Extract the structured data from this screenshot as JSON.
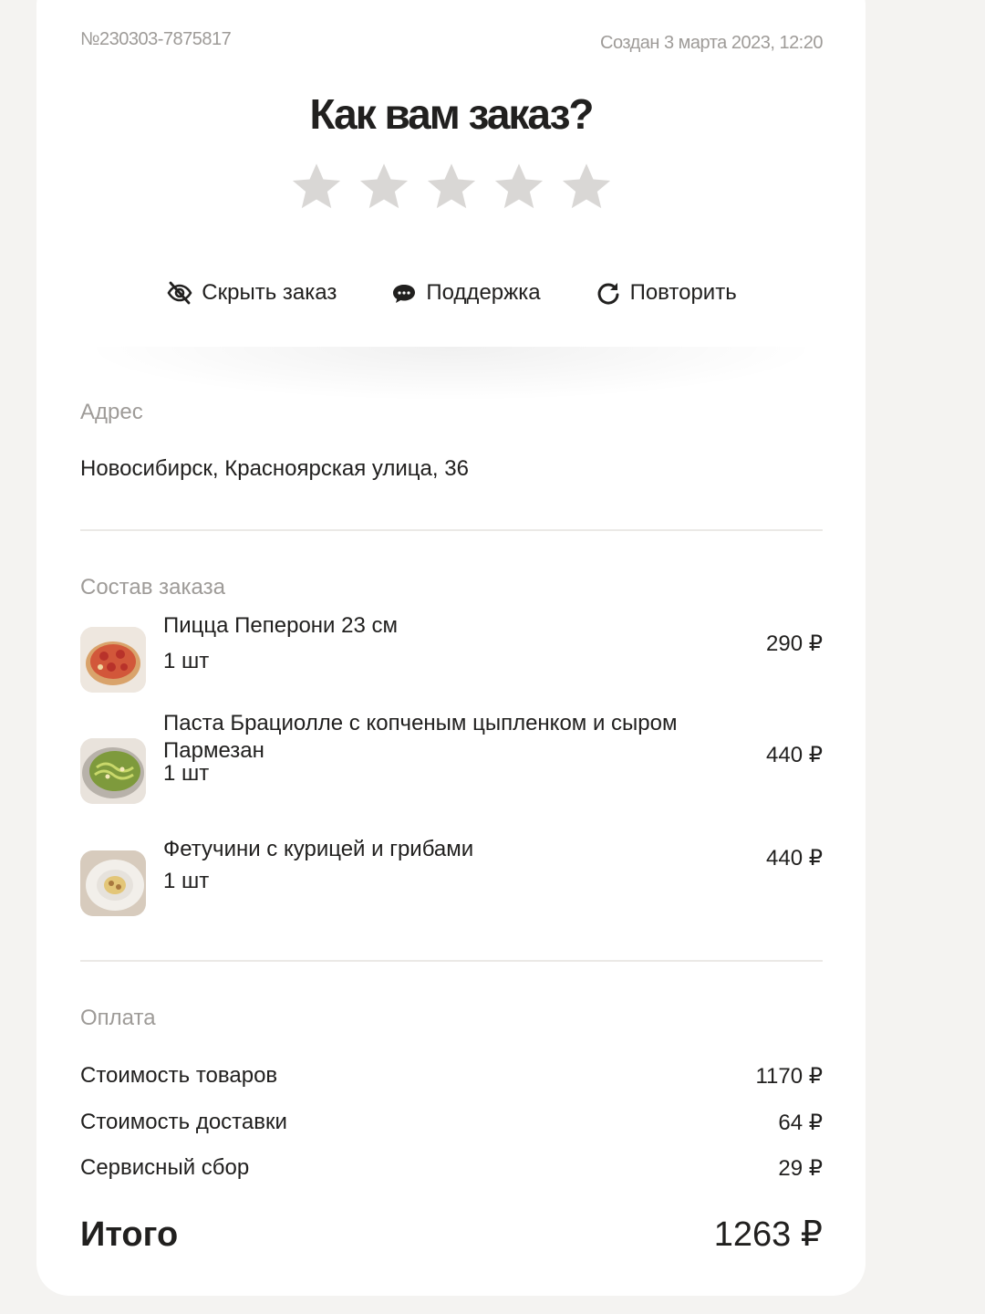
{
  "order": {
    "number": "№230303-7875817",
    "created": "Создан 3 марта 2023, 12:20",
    "title": "Как вам заказ?"
  },
  "rating": {
    "max_stars": 5,
    "selected": 0,
    "star_color": "#d9d7d5"
  },
  "actions": [
    {
      "label": "Скрыть заказ",
      "icon": "eye-off-icon"
    },
    {
      "label": "Поддержка",
      "icon": "chat-bubble-icon"
    },
    {
      "label": "Повторить",
      "icon": "refresh-icon"
    }
  ],
  "address": {
    "label": "Адрес",
    "value": "Новосибирск, Красноярская улица, 36"
  },
  "composition": {
    "label": "Состав заказа",
    "items": [
      {
        "name": "Пицца Пеперони 23 см",
        "qty": "1 шт",
        "price": "290 ₽",
        "image": "pizza-image"
      },
      {
        "name": "Паста Брациолле с копченым цыпленком и сыром Пармезан",
        "qty": "1 шт",
        "price": "440 ₽",
        "image": "pasta-image"
      },
      {
        "name": "Фетучини с курицей и грибами",
        "qty": "1 шт",
        "price": "440 ₽",
        "image": "fettuccine-image"
      }
    ]
  },
  "payment": {
    "label": "Оплата",
    "rows": [
      {
        "label": "Стоимость товаров",
        "value": "1170 ₽"
      },
      {
        "label": "Стоимость доставки",
        "value": "64 ₽"
      },
      {
        "label": "Сервисный сбор",
        "value": "29 ₽"
      }
    ],
    "total_label": "Итого",
    "total_value": "1263 ₽"
  },
  "colors": {
    "background": "#f4f3f1",
    "card": "#ffffff",
    "text": "#21201f",
    "muted": "#9e9b98"
  }
}
